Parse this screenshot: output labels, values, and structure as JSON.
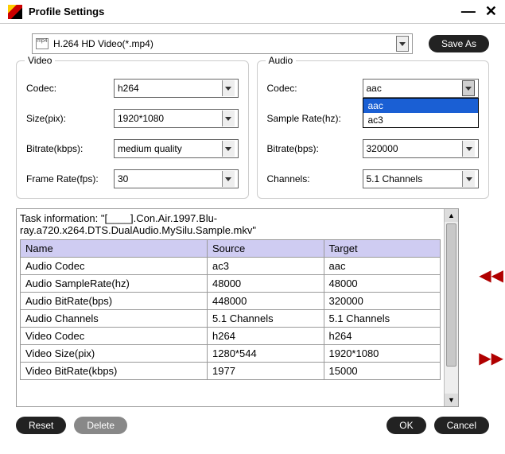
{
  "window": {
    "title": "Profile Settings",
    "minimize": "—",
    "close": "✕"
  },
  "toprow": {
    "profile_icon": "mp4",
    "profile_text": "H.264 HD Video(*.mp4)",
    "save_as": "Save As"
  },
  "video": {
    "heading": "Video",
    "codec_label": "Codec:",
    "codec_value": "h264",
    "size_label": "Size(pix):",
    "size_value": "1920*1080",
    "bitrate_label": "Bitrate(kbps):",
    "bitrate_value": "medium quality",
    "fps_label": "Frame Rate(fps):",
    "fps_value": "30"
  },
  "audio": {
    "heading": "Audio",
    "codec_label": "Codec:",
    "codec_value": "aac",
    "codec_options": [
      "aac",
      "ac3"
    ],
    "sr_label": "Sample Rate(hz):",
    "br_label": "Bitrate(bps):",
    "br_value": "320000",
    "ch_label": "Channels:",
    "ch_value": "5.1 Channels"
  },
  "task_info": "Task information: \"[____].Con.Air.1997.Blu-ray.a720.x264.DTS.DualAudio.MySilu.Sample.mkv\"",
  "table": {
    "headers": [
      "Name",
      "Source",
      "Target"
    ],
    "rows": [
      [
        "Audio Codec",
        "ac3",
        "aac"
      ],
      [
        "Audio SampleRate(hz)",
        "48000",
        "48000"
      ],
      [
        "Audio BitRate(bps)",
        "448000",
        "320000"
      ],
      [
        "Audio Channels",
        "5.1 Channels",
        "5.1 Channels"
      ],
      [
        "Video Codec",
        "h264",
        "h264"
      ],
      [
        "Video Size(pix)",
        "1280*544",
        "1920*1080"
      ],
      [
        "Video BitRate(kbps)",
        "1977",
        "15000"
      ]
    ]
  },
  "buttons": {
    "reset": "Reset",
    "delete": "Delete",
    "ok": "OK",
    "cancel": "Cancel"
  }
}
